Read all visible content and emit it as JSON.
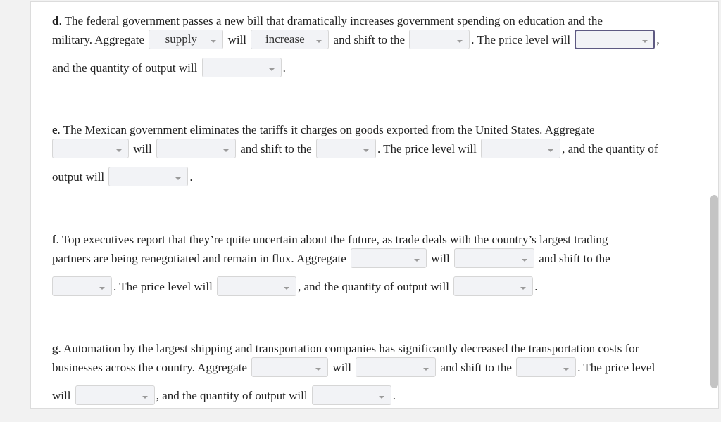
{
  "questions": {
    "d": {
      "letter": "d",
      "t1": ". The federal government passes a new bill that dramatically increases government spending on education and the",
      "t2": "military. Aggregate",
      "dd1": "supply",
      "t3": "will",
      "dd2": "increase",
      "t4": "and shift to the",
      "dd3": "",
      "t5": ". The price level will",
      "dd4": "",
      "t6": ",",
      "t7": "and the quantity of output will",
      "dd5": "",
      "t8": "."
    },
    "e": {
      "letter": "e",
      "t1": ". The Mexican government eliminates the tariffs it charges on goods exported from the United States. Aggregate",
      "dd1": "",
      "t2": "will",
      "dd2": "",
      "t3": "and shift to the",
      "dd3": "",
      "t4": ". The price level will",
      "dd4": "",
      "t5": ", and the quantity of",
      "t6": "output will",
      "dd5": "",
      "t7": "."
    },
    "f": {
      "letter": "f",
      "t1": ". Top executives report that they’re quite uncertain about the future, as trade deals with the country’s largest trading",
      "t2": "partners are being renegotiated and remain in flux. Aggregate",
      "dd1": "",
      "t3": "will",
      "dd2": "",
      "t4": "and shift to the",
      "dd3": "",
      "t5": ". The price level will",
      "dd4": "",
      "t6": ", and the quantity of output will",
      "dd5": "",
      "t7": "."
    },
    "g": {
      "letter": "g",
      "t1": ". Automation by the largest shipping and transportation companies has significantly decreased the transportation costs for",
      "t2": "businesses across the country. Aggregate",
      "dd1": "",
      "t3": "will",
      "dd2": "",
      "t4": "and shift to the",
      "dd3": "",
      "t5": ". The price level",
      "t6": "will",
      "dd4": "",
      "t7": ", and the quantity of output will",
      "dd5": "",
      "t8": "."
    }
  },
  "focused_dropdown": "d-price-level"
}
